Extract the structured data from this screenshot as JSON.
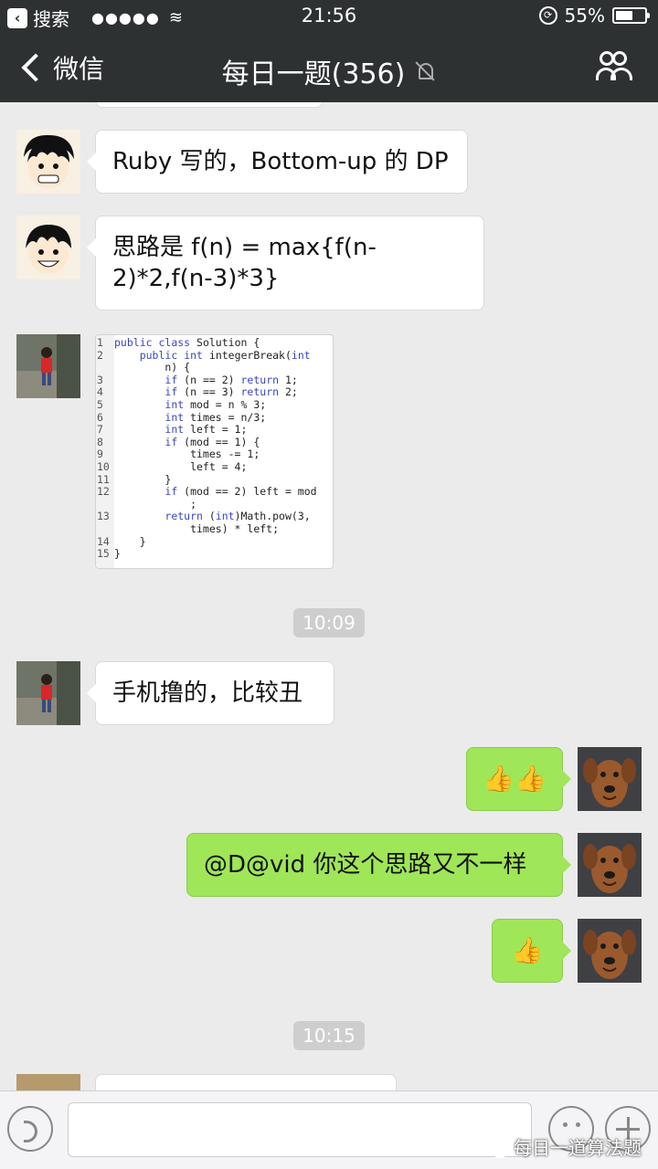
{
  "status_bar": {
    "back_app": "搜索",
    "signal": "●●●●●",
    "time": "21:56",
    "battery": "55%",
    "battery_level": 0.55
  },
  "nav": {
    "back_label": "微信",
    "title": "每日一题(356)"
  },
  "messages": [
    {
      "side": "left",
      "text": "Ruby 写的，Bottom-up 的 DP",
      "avatar": "cartoon-boy-avatar"
    },
    {
      "side": "left",
      "text": "思路是 f(n) = max{f(n-2)*2,f(n-3)*3}",
      "avatar": "cartoon-boy-avatar"
    },
    {
      "side": "left",
      "type": "image",
      "avatar": "child-photo-avatar"
    },
    {
      "side": "left",
      "text": "手机撸的，比较丑",
      "avatar": "child-photo-avatar"
    },
    {
      "side": "right",
      "text": "👍👍",
      "avatar": "dog-avatar"
    },
    {
      "side": "right",
      "text": "@D@vid 你这个思路又不一样",
      "avatar": "dog-avatar"
    },
    {
      "side": "right",
      "text": "👍",
      "avatar": "dog-avatar"
    }
  ],
  "timestamps": [
    "10:09",
    "10:15"
  ],
  "code_lines": [
    {
      "n": "1",
      "t": "public class Solution {"
    },
    {
      "n": "2",
      "t": "    public int integerBreak(int"
    },
    {
      "n": "",
      "t": "        n) {"
    },
    {
      "n": "3",
      "t": "        if (n == 2) return 1;"
    },
    {
      "n": "4",
      "t": "        if (n == 3) return 2;"
    },
    {
      "n": "5",
      "t": "        int mod = n % 3;"
    },
    {
      "n": "6",
      "t": "        int times = n/3;"
    },
    {
      "n": "7",
      "t": "        int left = 1;"
    },
    {
      "n": "8",
      "t": "        if (mod == 1) {"
    },
    {
      "n": "9",
      "t": "            times -= 1;"
    },
    {
      "n": "10",
      "t": "            left = 4;"
    },
    {
      "n": "11",
      "t": "        }"
    },
    {
      "n": "12",
      "t": "        if (mod == 2) left = mod"
    },
    {
      "n": "",
      "t": "            ;"
    },
    {
      "n": "13",
      "t": "        return (int)Math.pow(3,"
    },
    {
      "n": "",
      "t": "            times) * left;"
    },
    {
      "n": "14",
      "t": "    }"
    },
    {
      "n": "15",
      "t": "}"
    }
  ],
  "watermark": "每日一道算法题",
  "colors": {
    "nav_bg": "#2e3132",
    "chat_bg": "#ebebeb",
    "bubble_self": "#9fe658"
  }
}
